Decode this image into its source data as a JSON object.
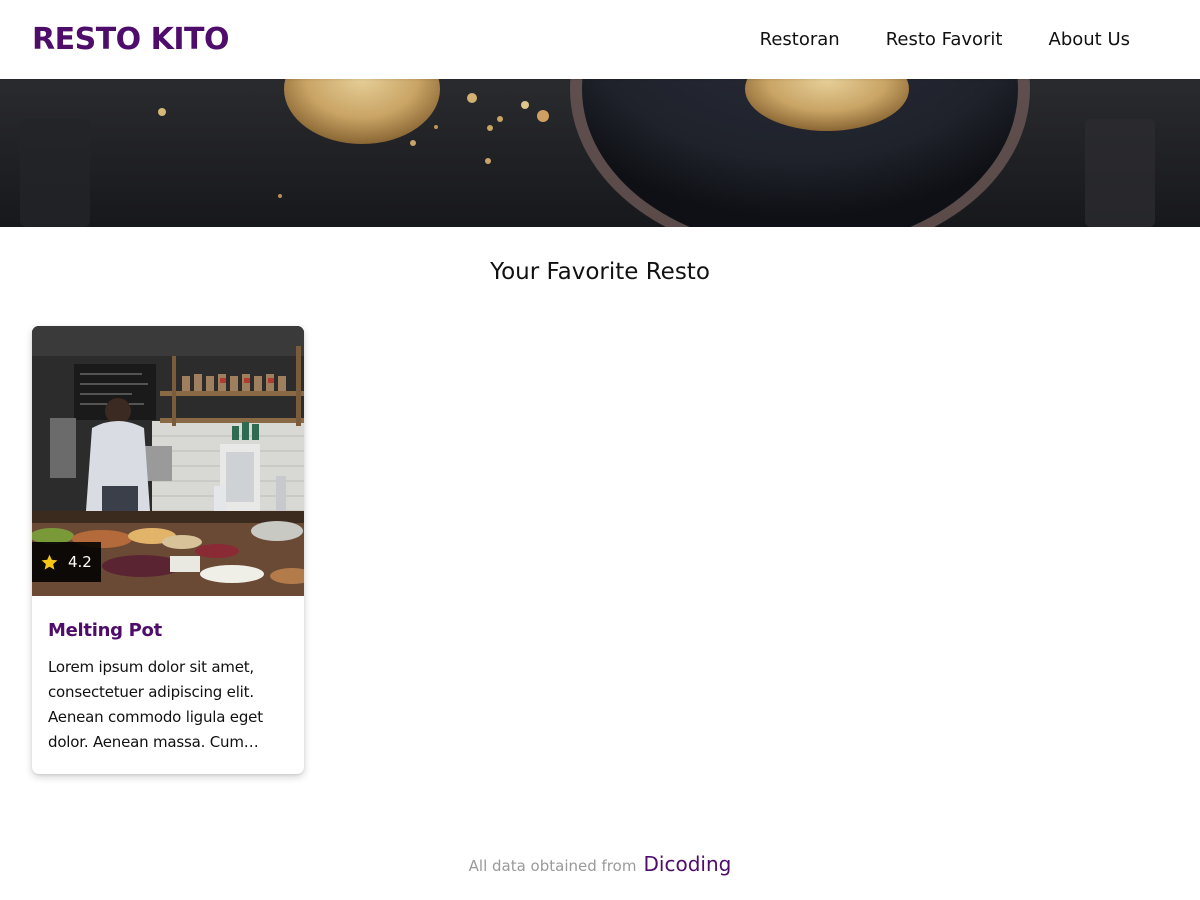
{
  "colors": {
    "brand": "#4f0d6b",
    "text": "#111111",
    "muted": "#9a9a9a",
    "rating_star": "#f5c518"
  },
  "header": {
    "brand": "RESTO KITO",
    "nav": [
      {
        "label": "Restoran"
      },
      {
        "label": "Resto Favorit"
      },
      {
        "label": "About Us"
      }
    ]
  },
  "hero": {
    "image": "cookies-on-dark-table"
  },
  "main": {
    "title": "Your Favorite Resto",
    "cards": [
      {
        "name": "Melting Pot",
        "rating": "4.2",
        "image": "restaurant-kitchen-counter",
        "rating_icon": "star-icon",
        "description": "Lorem ipsum dolor sit amet, consectetuer adipiscing elit. Aenean commodo ligula eget dolor. Aenean massa. Cum sociis natoque penatibus et magnis dis parturient montes, nascetur ridiculus mus."
      }
    ]
  },
  "footer": {
    "text": "All data obtained from",
    "link": "Dicoding"
  }
}
